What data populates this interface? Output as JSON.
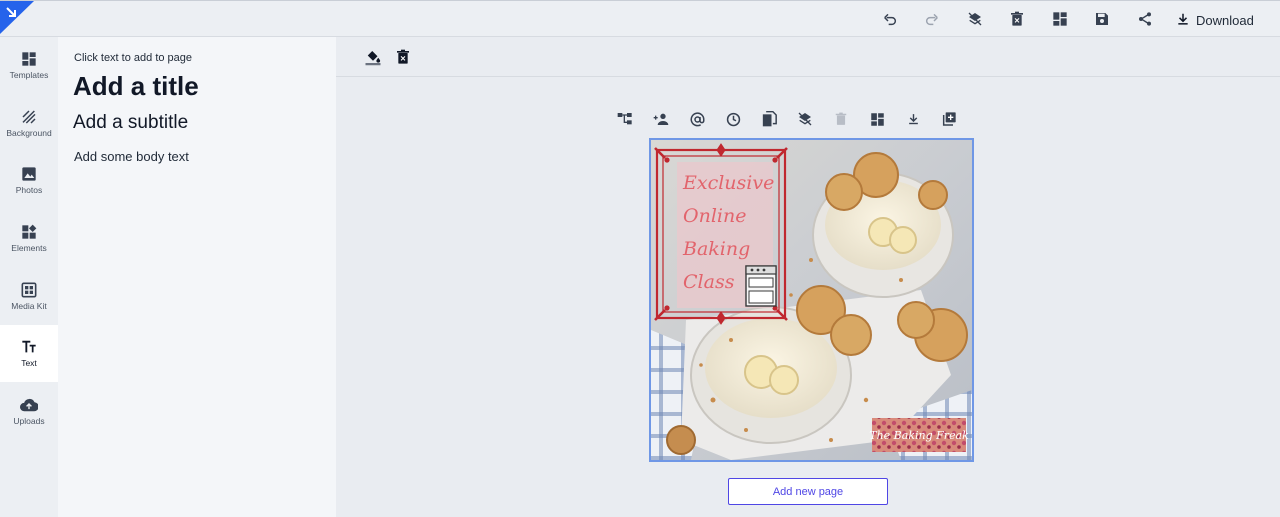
{
  "topbar": {
    "download_label": "Download",
    "icons": [
      "undo-icon",
      "redo-icon",
      "layers-icon",
      "delete-icon",
      "dashboard-icon",
      "save-icon",
      "share-icon",
      "download-icon"
    ]
  },
  "rail": {
    "items": [
      {
        "label": "Templates",
        "icon": "templates-icon"
      },
      {
        "label": "Background",
        "icon": "background-icon"
      },
      {
        "label": "Photos",
        "icon": "photos-icon"
      },
      {
        "label": "Elements",
        "icon": "elements-icon"
      },
      {
        "label": "Media Kit",
        "icon": "media-kit-icon"
      },
      {
        "label": "Text",
        "icon": "text-icon",
        "active": true
      },
      {
        "label": "Uploads",
        "icon": "uploads-icon"
      }
    ]
  },
  "panel": {
    "hint": "Click text to add to page",
    "title": "Add a title",
    "subtitle": "Add a subtitle",
    "body": "Add some body text"
  },
  "canvas": {
    "headline_lines": [
      "Exclusive",
      "Online",
      "Baking",
      "Class"
    ],
    "brand": "The Baking Freak"
  },
  "workspace": {
    "add_page_label": "Add new page"
  },
  "colors": {
    "accent": "#4f46e5",
    "selection": "#6f97e6",
    "frame_red": "#c0282f",
    "headline_pink": "#e2646c"
  }
}
